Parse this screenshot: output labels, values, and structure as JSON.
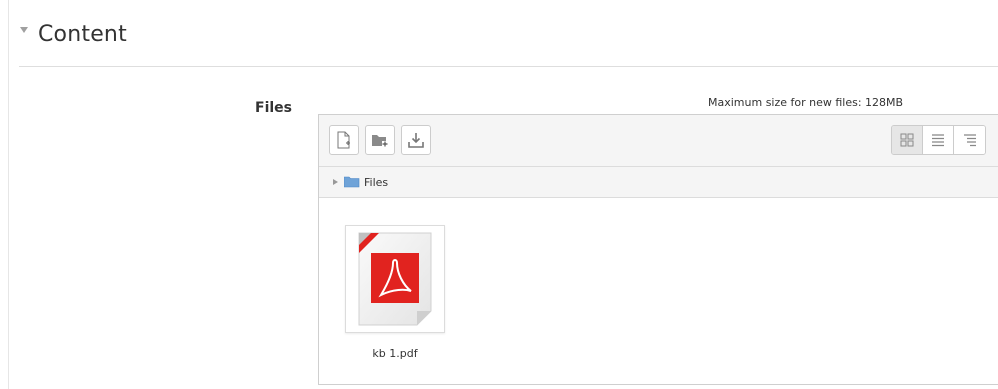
{
  "section": {
    "title": "Content",
    "collapse_icon": "caret-down-icon"
  },
  "files_field": {
    "label": "Files",
    "max_size_text": "Maximum size for new files: 128MB"
  },
  "toolbar": {
    "buttons": [
      {
        "name": "add-file-button",
        "icon": "add-file-icon"
      },
      {
        "name": "create-folder-button",
        "icon": "create-folder-icon"
      },
      {
        "name": "download-button",
        "icon": "download-icon"
      }
    ],
    "views": [
      {
        "name": "view-icons-button",
        "icon": "grid-icon",
        "active": true
      },
      {
        "name": "view-details-button",
        "icon": "list-icon",
        "active": false
      },
      {
        "name": "view-tree-button",
        "icon": "tree-icon",
        "active": false
      }
    ]
  },
  "path": {
    "label": "Files",
    "icon": "folder-icon"
  },
  "files": [
    {
      "name": "kb 1.pdf",
      "icon": "pdf-file-icon"
    }
  ],
  "colors": {
    "pdf_red": "#e1231f",
    "folder_blue": "#5b9bd5"
  }
}
